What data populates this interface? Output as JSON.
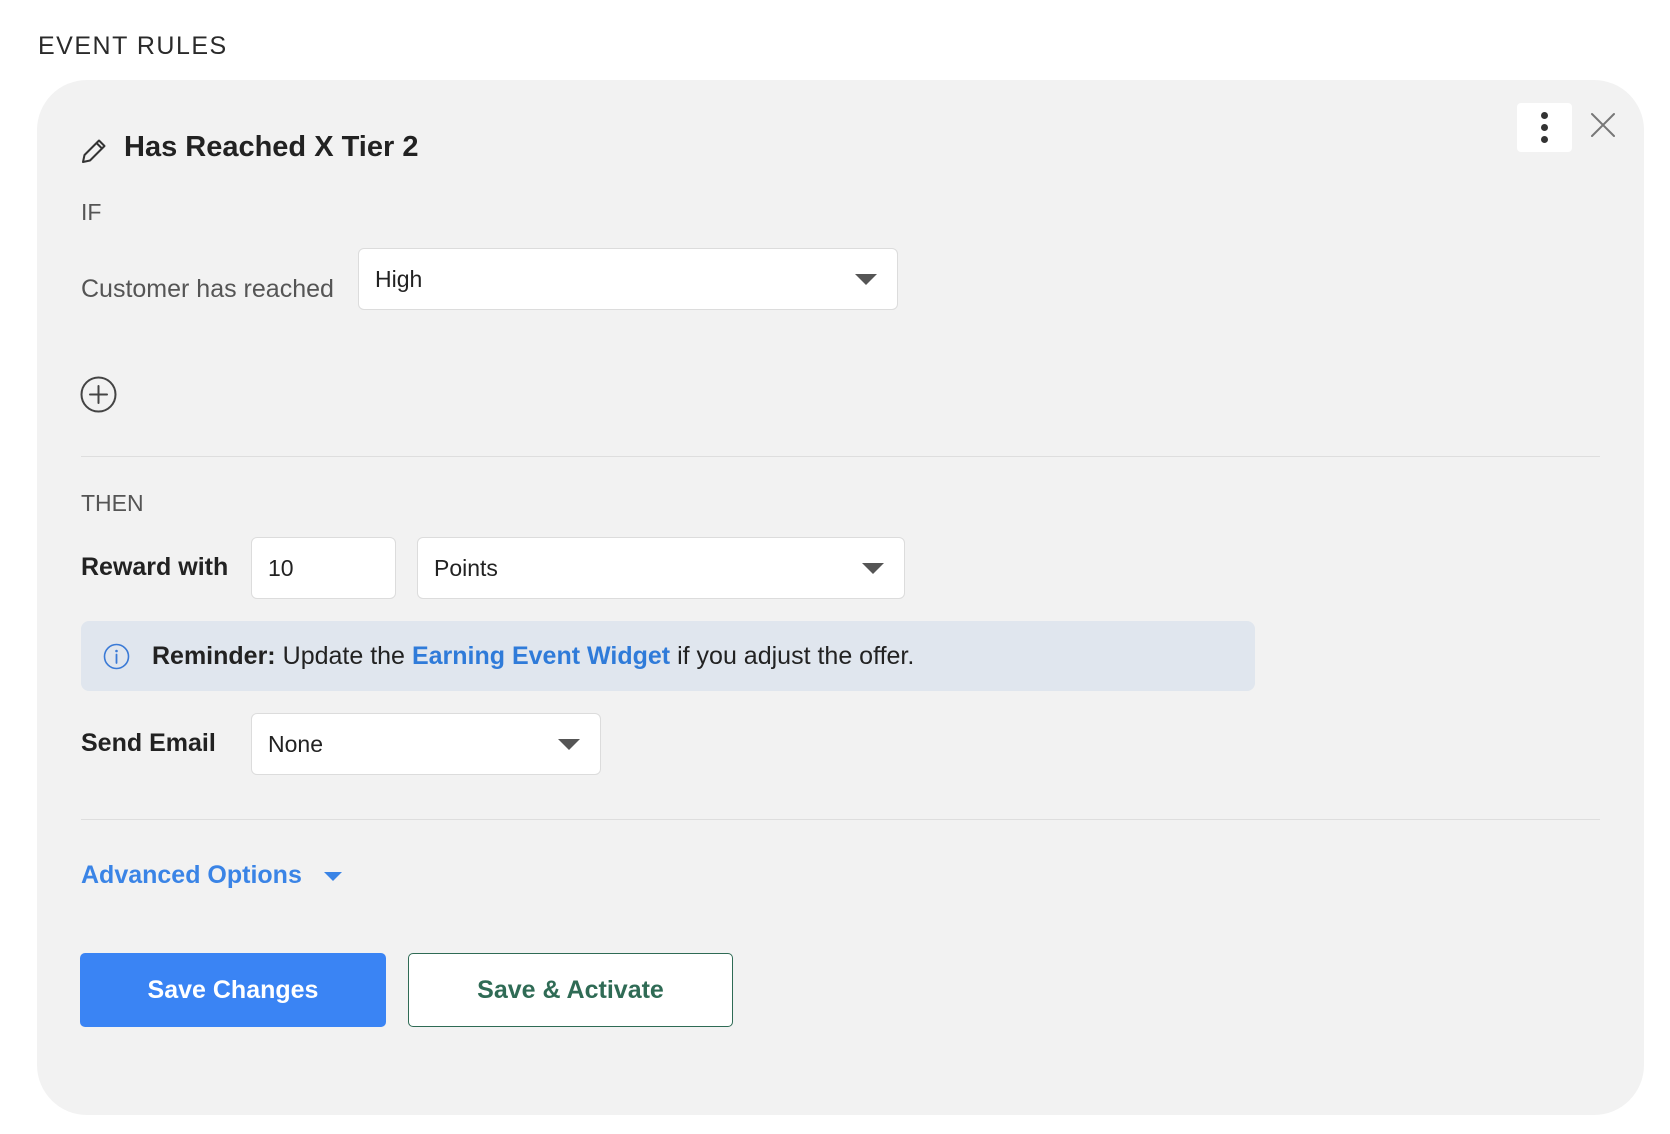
{
  "section": {
    "title": "EVENT RULES"
  },
  "rule": {
    "title": "Has Reached X Tier 2",
    "if_label": "IF",
    "condition_label": "Customer has reached",
    "condition_value": "High",
    "then_label": "THEN",
    "reward_label": "Reward with",
    "reward_amount": "10",
    "reward_unit": "Points",
    "reminder": {
      "bold": "Reminder:",
      "text_before": "Update the",
      "link": "Earning Event Widget",
      "text_after": "if you adjust the offer."
    },
    "email_label": "Send Email",
    "email_value": "None",
    "advanced_label": "Advanced Options"
  },
  "buttons": {
    "save": "Save Changes",
    "save_activate": "Save & Activate"
  },
  "icons": {
    "edit": "pencil-icon",
    "more": "kebab-menu-icon",
    "close": "close-icon",
    "add": "plus-circle-icon",
    "info": "info-icon",
    "dropdown": "caret-down-icon"
  },
  "colors": {
    "card_bg": "#f2f2f2",
    "primary": "#3a84f4",
    "link": "#2f7bd9",
    "outline_green": "#2f6b55",
    "reminder_bg": "#e0e6ee"
  }
}
